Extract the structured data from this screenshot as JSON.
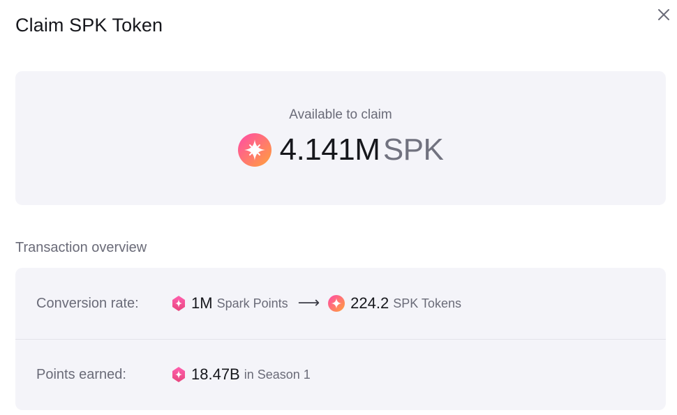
{
  "dialog": {
    "title": "Claim SPK Token",
    "close_icon": "close-icon"
  },
  "claim": {
    "label": "Available to claim",
    "amount": "4.141M",
    "unit": "SPK",
    "icon": "spk-token-icon"
  },
  "overview": {
    "title": "Transaction overview",
    "conversion": {
      "label": "Conversion rate:",
      "from_icon": "spark-points-icon",
      "from_amount": "1M",
      "from_unit": "Spark Points",
      "arrow": "⟶",
      "to_icon": "spk-token-icon",
      "to_amount": "224.2",
      "to_unit": "SPK Tokens"
    },
    "points": {
      "label": "Points earned:",
      "icon": "spark-points-icon",
      "amount": "18.47B",
      "suffix": "in Season 1"
    }
  },
  "colors": {
    "card_bg": "#f4f4f9",
    "text_primary": "#16171c",
    "text_secondary": "#6a6b78",
    "token_gradient_start": "#ff4fa8",
    "token_gradient_end": "#ff9a3c"
  }
}
